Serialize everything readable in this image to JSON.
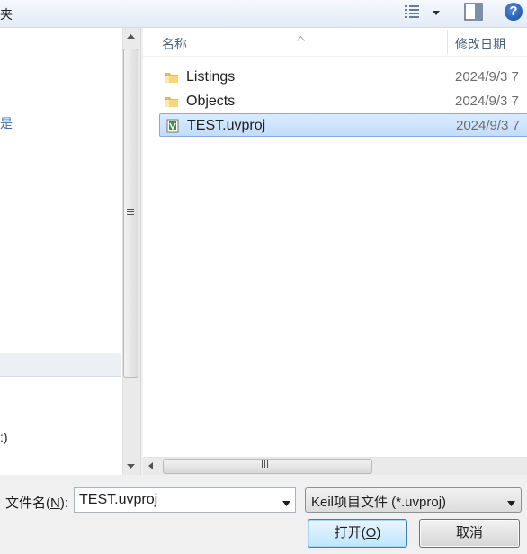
{
  "toolbar": {
    "left_text": "夹",
    "view_icon": "view-options-icon",
    "help_icon": "help-icon",
    "help_glyph": "?"
  },
  "nav": {
    "char_1": "是",
    "drive_text": ":)"
  },
  "columns": {
    "name": "名称",
    "date": "修改日期"
  },
  "files": [
    {
      "name": "Listings",
      "date": "2024/9/3 7",
      "icon": "folder-icon",
      "selected": false
    },
    {
      "name": "Objects",
      "date": "2024/9/3 7",
      "icon": "folder-icon",
      "selected": false
    },
    {
      "name": "TEST.uvproj",
      "date": "2024/9/3 7",
      "icon": "uvproj-file-icon",
      "selected": true
    }
  ],
  "filename": {
    "label_prefix": "文件名(",
    "label_key": "N",
    "label_suffix": "):",
    "value": "TEST.uvproj"
  },
  "filetype": {
    "selected": "Keil项目文件 (*.uvproj)"
  },
  "buttons": {
    "open_prefix": "打开(",
    "open_key": "O",
    "open_suffix": ")",
    "cancel": "取消"
  },
  "colors": {
    "selection_border": "#84acdd",
    "selection_fill": "#cce4fc",
    "open_button_border": "#3c7fb1"
  }
}
